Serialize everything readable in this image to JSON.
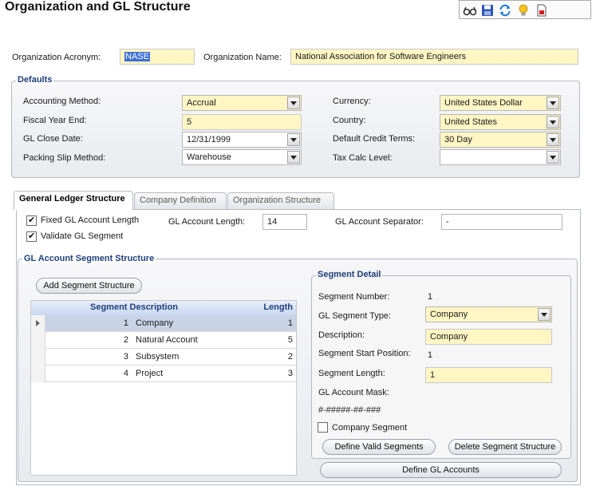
{
  "page": {
    "title": "Organization and GL Structure"
  },
  "toolbar": {
    "icons": [
      "glasses-icon",
      "save-icon",
      "refresh-icon",
      "lightbulb-icon",
      "document-icon"
    ]
  },
  "org": {
    "acronym_label": "Organization Acronym:",
    "acronym_value": "NASE",
    "name_label": "Organization Name:",
    "name_value": "National Association for Software Engineers"
  },
  "defaults": {
    "title": "Defaults",
    "accounting_method_label": "Accounting Method:",
    "accounting_method_value": "Accrual",
    "fiscal_year_end_label": "Fiscal Year End:",
    "fiscal_year_end_value": "5",
    "gl_close_date_label": "GL Close Date:",
    "gl_close_date_value": "12/31/1999",
    "packing_slip_label": "Packing Slip Method:",
    "packing_slip_value": "Warehouse",
    "currency_label": "Currency:",
    "currency_value": "United States Dollar",
    "country_label": "Country:",
    "country_value": "United States",
    "credit_terms_label": "Default Credit Terms:",
    "credit_terms_value": "30 Day",
    "tax_calc_label": "Tax Calc Level:",
    "tax_calc_value": ""
  },
  "tabs": [
    "General Ledger Structure",
    "Company Definition",
    "Organization Structure"
  ],
  "gl": {
    "fixed_length_label": "Fixed GL Account Length",
    "fixed_length_checked": true,
    "validate_label": "Validate GL Segment",
    "validate_checked": true,
    "account_length_label": "GL Account Length:",
    "account_length_value": "14",
    "separator_label": "GL Account Separator:",
    "separator_value": "-"
  },
  "segment_structure": {
    "title": "GL Account Segment Structure",
    "add_button": "Add Segment Structure",
    "columns": {
      "description": "Segment Description",
      "length": "Length"
    },
    "rows": [
      {
        "num": "1",
        "desc": "Company",
        "length": "1"
      },
      {
        "num": "2",
        "desc": "Natural Account",
        "length": "5"
      },
      {
        "num": "3",
        "desc": "Subsystem",
        "length": "2"
      },
      {
        "num": "4",
        "desc": "Project",
        "length": "3"
      }
    ]
  },
  "segment_detail": {
    "title": "Segment Detail",
    "number_label": "Segment Number:",
    "number_value": "1",
    "type_label": "GL Segment Type:",
    "type_value": "Company",
    "description_label": "Description:",
    "description_value": "Company",
    "start_label": "Segment Start Position:",
    "start_value": "1",
    "length_label": "Segment Length:",
    "length_value": "1",
    "mask_label": "GL Account Mask:",
    "mask_value": "#-#####-##-###",
    "company_segment_label": "Company Segment",
    "company_segment_checked": false,
    "define_valid_button": "Define Valid Segments",
    "delete_button": "Delete Segment Structure"
  },
  "define_gl_button": "Define GL Accounts"
}
